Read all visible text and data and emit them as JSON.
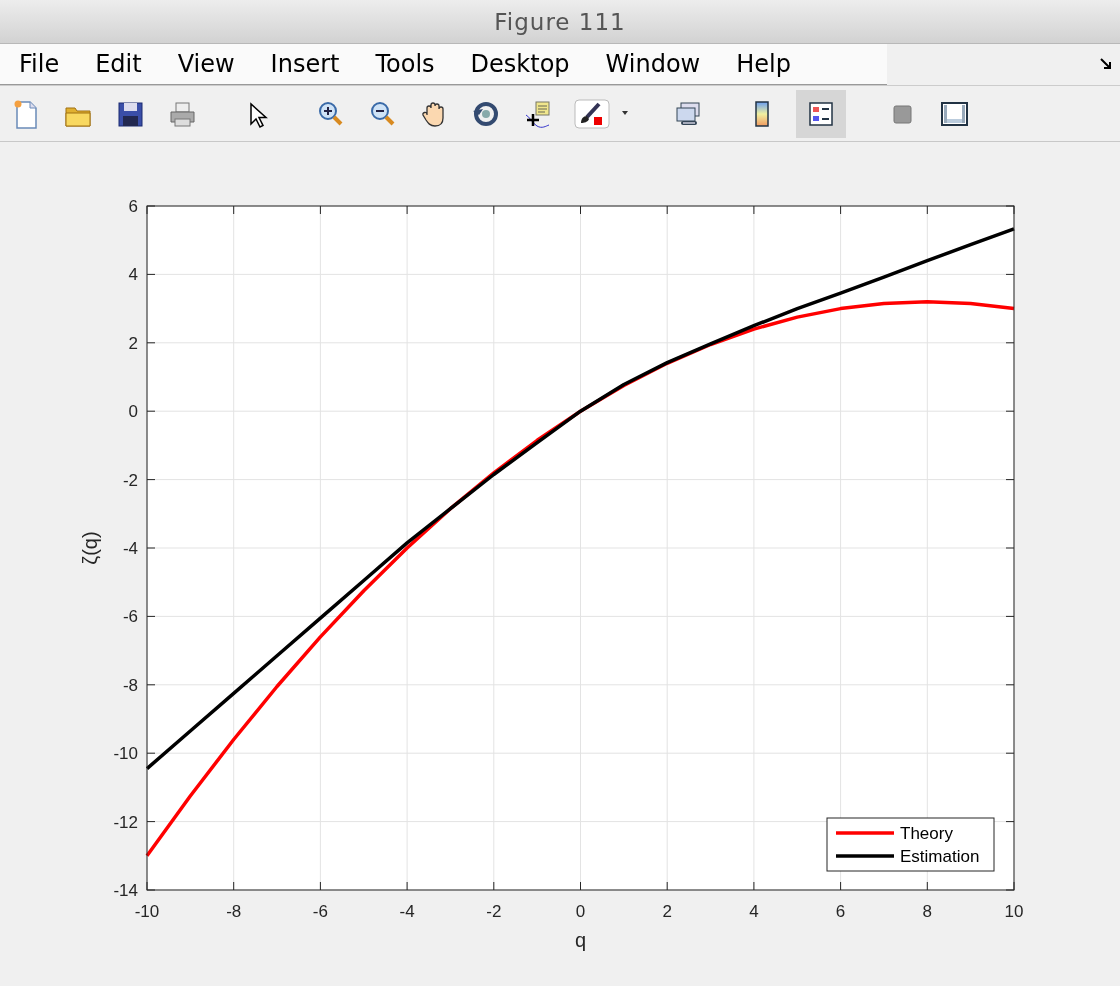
{
  "window": {
    "title": "Figure 111"
  },
  "menu": [
    {
      "label": "File"
    },
    {
      "label": "Edit"
    },
    {
      "label": "View"
    },
    {
      "label": "Insert"
    },
    {
      "label": "Tools"
    },
    {
      "label": "Desktop"
    },
    {
      "label": "Window"
    },
    {
      "label": "Help"
    }
  ],
  "toolbar": [
    {
      "items": [
        {
          "kind": "new",
          "pressed": false
        },
        {
          "kind": "open",
          "pressed": false
        },
        {
          "kind": "save",
          "pressed": false
        },
        {
          "kind": "print",
          "pressed": false
        }
      ]
    },
    {
      "items": [
        {
          "kind": "pointer",
          "pressed": false
        }
      ]
    },
    {
      "items": [
        {
          "kind": "zoomin",
          "pressed": false
        },
        {
          "kind": "zoomout",
          "pressed": false
        },
        {
          "kind": "pan",
          "pressed": false
        },
        {
          "kind": "rotate",
          "pressed": false
        },
        {
          "kind": "cursor",
          "pressed": false
        },
        {
          "kind": "brush",
          "pressed": false
        },
        {
          "kind": "caret",
          "pressed": false
        }
      ]
    },
    {
      "items": [
        {
          "kind": "link",
          "pressed": false
        }
      ]
    },
    {
      "items": [
        {
          "kind": "colorbar",
          "pressed": false
        },
        {
          "kind": "legend",
          "pressed": true
        }
      ]
    },
    {
      "items": [
        {
          "kind": "hide",
          "pressed": false
        },
        {
          "kind": "show",
          "pressed": false
        }
      ]
    }
  ],
  "chart_data": {
    "type": "line",
    "grid": true,
    "legend": true,
    "xlabel": "q",
    "ylabel": "ζ(q)",
    "xlim": [
      -10,
      10
    ],
    "ylim": [
      -14,
      6
    ],
    "xticks": [
      -10,
      -8,
      -6,
      -4,
      -2,
      0,
      2,
      4,
      6,
      8,
      10
    ],
    "yticks": [
      -14,
      -12,
      -10,
      -8,
      -6,
      -4,
      -2,
      0,
      2,
      4,
      6
    ],
    "x": [
      -10,
      -9,
      -8,
      -7,
      -6,
      -5,
      -4,
      -3,
      -2,
      -1,
      0,
      1,
      2,
      3,
      4,
      5,
      6,
      7,
      8,
      9,
      10
    ],
    "series": [
      {
        "name": "Theory",
        "color": "#ff0000",
        "values": [
          -13,
          -11.25,
          -9.6,
          -8.05,
          -6.6,
          -5.25,
          -4,
          -2.85,
          -1.8,
          -0.85,
          0,
          0.75,
          1.4,
          1.95,
          2.4,
          2.75,
          3,
          3.15,
          3.2,
          3.15,
          3
        ]
      },
      {
        "name": "Estimation",
        "color": "#000000",
        "values": [
          -10.45,
          -9.35,
          -8.25,
          -7.15,
          -6.05,
          -4.95,
          -3.85,
          -2.85,
          -1.85,
          -0.92,
          0,
          0.78,
          1.42,
          1.97,
          2.5,
          3,
          3.45,
          3.92,
          4.4,
          4.87,
          5.33
        ]
      }
    ]
  }
}
